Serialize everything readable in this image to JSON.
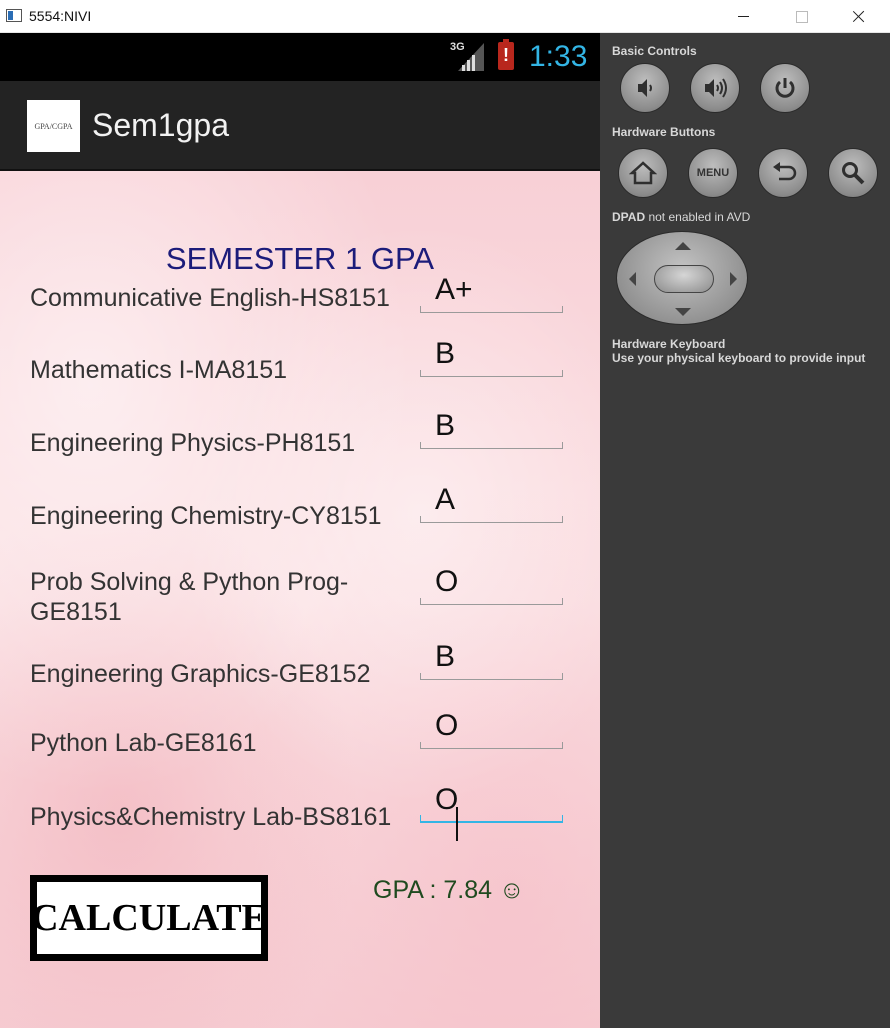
{
  "window": {
    "title": "5554:NIVI",
    "minimize_icon": "minimize-icon",
    "maximize_icon": "maximize-icon",
    "close_icon": "close-icon"
  },
  "status_bar": {
    "network": "3G",
    "battery_alert": "!",
    "time": "1:33",
    "clock_color": "#33b5e5"
  },
  "action_bar": {
    "app_icon_text": "GPA/CGPA",
    "title": "Sem1gpa"
  },
  "main": {
    "heading": "SEMESTER 1 GPA",
    "subjects": [
      {
        "name": "Communicative English-HS8151",
        "grade": "A+"
      },
      {
        "name": "Mathematics I-MA8151",
        "grade": "B"
      },
      {
        "name": "Engineering Physics-PH8151",
        "grade": "B"
      },
      {
        "name": "Engineering Chemistry-CY8151",
        "grade": "A"
      },
      {
        "name": "Prob Solving & Python Prog-GE8151",
        "grade": "O"
      },
      {
        "name": "Engineering Graphics-GE8152",
        "grade": "B"
      },
      {
        "name": "Python Lab-GE8161",
        "grade": "O"
      },
      {
        "name": "Physics&Chemistry Lab-BS8161",
        "grade": "O"
      }
    ],
    "calculate_label": "CALCULATE",
    "gpa_text": "GPA :  7.84 ☺"
  },
  "emulator": {
    "basic_controls_label": "Basic Controls",
    "hardware_buttons_label": "Hardware Buttons",
    "menu_label": "MENU",
    "dpad_label_bold": "DPAD",
    "dpad_label_rest": " not enabled in AVD",
    "keyboard_title": "Hardware Keyboard",
    "keyboard_hint": "Use your physical keyboard to provide input"
  }
}
